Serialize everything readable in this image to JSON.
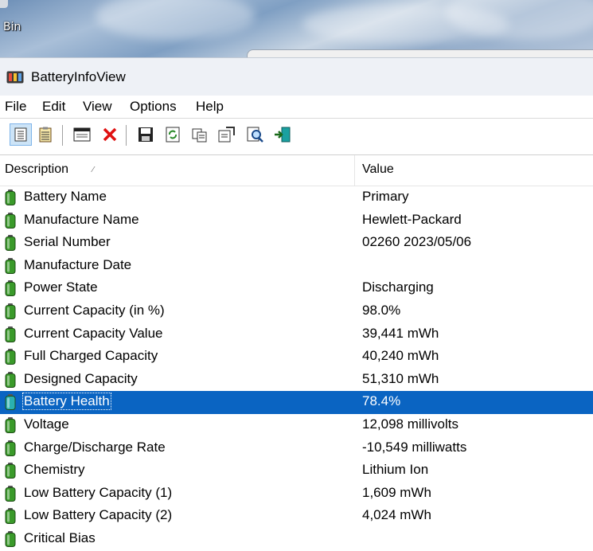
{
  "desktop": {
    "bin_label": "Bin"
  },
  "window": {
    "title": "BatteryInfoView"
  },
  "menu": [
    "File",
    "Edit",
    "View",
    "Options",
    "Help"
  ],
  "toolbar": {
    "buttons": [
      {
        "icon": "properties-view-icon",
        "pressed": true
      },
      {
        "icon": "clipboard-list-icon",
        "pressed": false
      },
      {
        "icon": "window-icon",
        "pressed": false
      },
      {
        "icon": "delete-x-icon",
        "pressed": false
      },
      {
        "icon": "save-disk-icon",
        "pressed": false
      },
      {
        "icon": "refresh-icon",
        "pressed": false
      },
      {
        "icon": "copy-icon",
        "pressed": false
      },
      {
        "icon": "properties-icon",
        "pressed": false
      },
      {
        "icon": "find-icon",
        "pressed": false
      },
      {
        "icon": "exit-icon",
        "pressed": false
      }
    ]
  },
  "columns": {
    "description": "Description",
    "value": "Value",
    "sort_glyph": "⁄"
  },
  "rows": [
    {
      "description": "Battery Name",
      "value": "Primary"
    },
    {
      "description": "Manufacture Name",
      "value": "Hewlett-Packard"
    },
    {
      "description": "Serial Number",
      "value": "02260 2023/05/06"
    },
    {
      "description": "Manufacture Date",
      "value": ""
    },
    {
      "description": "Power State",
      "value": "Discharging"
    },
    {
      "description": "Current Capacity (in %)",
      "value": "98.0%"
    },
    {
      "description": "Current Capacity Value",
      "value": "39,441 mWh"
    },
    {
      "description": "Full Charged Capacity",
      "value": "40,240 mWh"
    },
    {
      "description": "Designed Capacity",
      "value": "51,310 mWh"
    },
    {
      "description": "Battery Health",
      "value": "78.4%",
      "selected": true
    },
    {
      "description": "Voltage",
      "value": "12,098 millivolts"
    },
    {
      "description": "Charge/Discharge Rate",
      "value": "-10,549 milliwatts"
    },
    {
      "description": "Chemistry",
      "value": "Lithium Ion"
    },
    {
      "description": "Low Battery Capacity (1)",
      "value": "1,609 mWh"
    },
    {
      "description": "Low Battery Capacity (2)",
      "value": "4,024 mWh"
    },
    {
      "description": "Critical Bias",
      "value": ""
    }
  ],
  "colors": {
    "selection": "#0a64c2",
    "battery_green": "#3a9a2a"
  }
}
